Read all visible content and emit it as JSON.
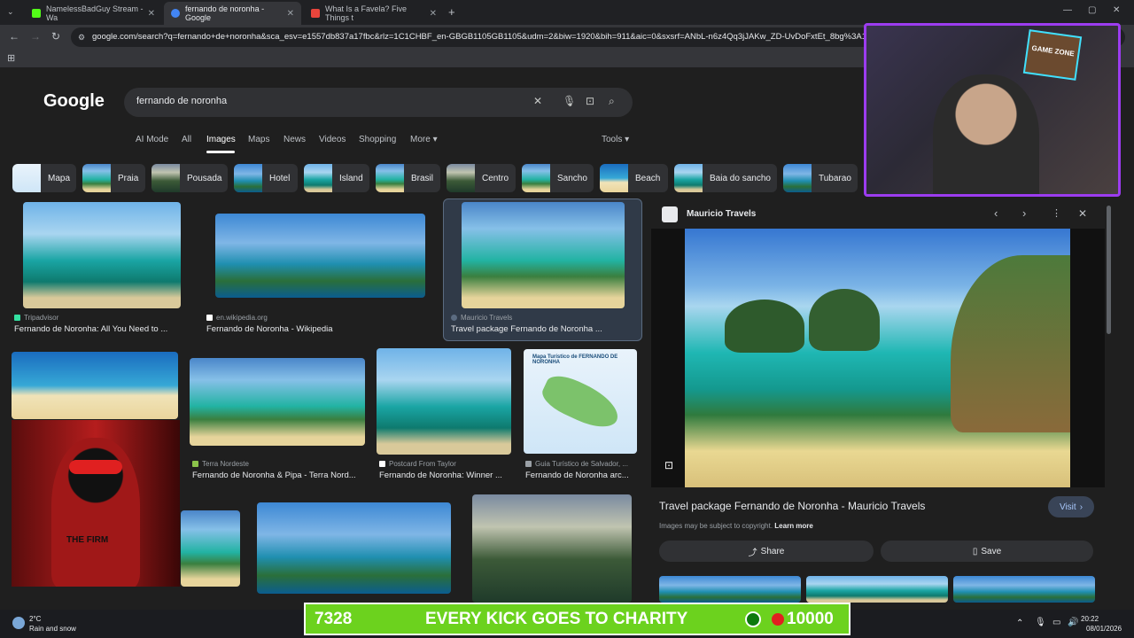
{
  "browser": {
    "tabs": [
      {
        "title": "NamelessBadGuy Stream - Wa",
        "color": "#53fc18"
      },
      {
        "title": "fernando de noronha - Google",
        "color": "#4285f4"
      },
      {
        "title": "What Is a Favela? Five Things t",
        "color": "#e8453c"
      }
    ],
    "url": "google.com/search?q=fernando+de+noronha&sca_esv=e1557db837a17fbc&rlz=1C1CHBF_en-GBGB1105GB1105&udm=2&biw=1920&bih=911&aic=0&sxsrf=ANbL-n6z4Qq3jJAKw_ZD-UvDoFxtEt_8bg%3A1767"
  },
  "google": {
    "logo": "Google",
    "query": "fernando de noronha",
    "nav": [
      "AI Mode",
      "All",
      "Images",
      "Maps",
      "News",
      "Videos",
      "Shopping",
      "More"
    ],
    "tools": "Tools",
    "chips": [
      "Mapa",
      "Praia",
      "Pousada",
      "Hotel",
      "Island",
      "Brasil",
      "Centro",
      "Sancho",
      "Beach",
      "Baia do sancho",
      "Tubarao"
    ]
  },
  "results": {
    "r1": {
      "source": "Tripadvisor",
      "title": "Fernando de Noronha: All You Need to ..."
    },
    "r2": {
      "source": "en.wikipedia.org",
      "title": "Fernando de Noronha - Wikipedia"
    },
    "r3": {
      "source": "Mauricio Travels",
      "title": "Travel package Fernando de Noronha ..."
    },
    "r4": {
      "source": "Terra Nordeste",
      "title": "Fernando de Noronha & Pipa - Terra Nord..."
    },
    "r5": {
      "source": "Postcard From Taylor",
      "title": "Fernando de Noronha: Winner ..."
    },
    "r6": {
      "source": "Guia Turístico de Salvador, ...",
      "title": "Fernando de Noronha arc..."
    },
    "map_caption": "Mapa Turístico de FERNANDO DE NORONHA"
  },
  "preview": {
    "source": "Mauricio Travels",
    "title": "Travel package Fernando de Noronha - Mauricio Travels",
    "visit": "Visit",
    "copyright": "Images may be subject to copyright.",
    "learn_more": "Learn more",
    "share": "Share",
    "save": "Save"
  },
  "overlay": {
    "game_zone": "GAME ZONE",
    "banner_left": "7328",
    "banner_text": "EVERY KICK GOES TO CHARITY",
    "banner_right": "10000",
    "the_firm": "THE FIRM"
  },
  "taskbar": {
    "temp": "2°C",
    "weather": "Rain and snow",
    "time": "20:22",
    "date": "08/01/2026"
  }
}
